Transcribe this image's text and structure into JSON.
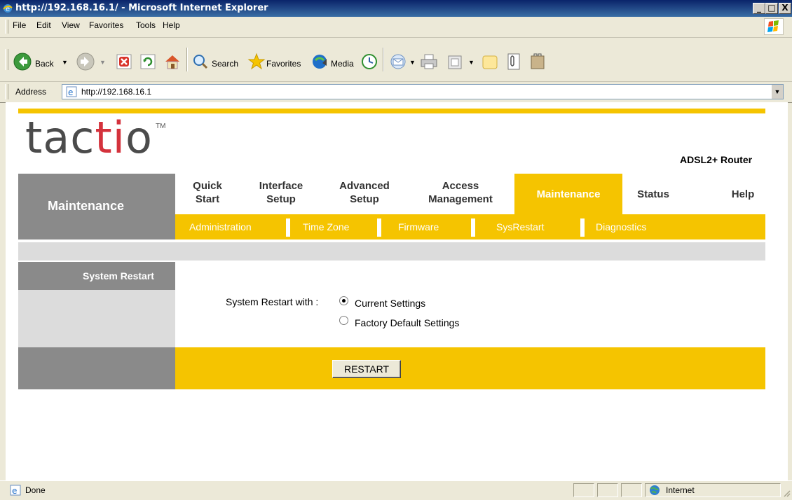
{
  "window": {
    "title": "http://192.168.16.1/ - Microsoft Internet Explorer",
    "controls": [
      "_",
      "□",
      "X"
    ]
  },
  "menu": [
    "File",
    "Edit",
    "View",
    "Favorites",
    "Tools",
    "Help"
  ],
  "toolbar": {
    "back": "Back",
    "search": "Search",
    "favorites": "Favorites",
    "media": "Media"
  },
  "address": {
    "label": "Address",
    "url": "http://192.168.16.1"
  },
  "router": {
    "logo_prefix": "tac",
    "logo_accent": "ti",
    "logo_suffix": "o",
    "trademark": "TM",
    "model": "ADSL2+ Router",
    "section": "Maintenance",
    "nav": [
      {
        "line1": "Quick",
        "line2": "Start"
      },
      {
        "line1": "Interface",
        "line2": "Setup"
      },
      {
        "line1": "Advanced",
        "line2": "Setup"
      },
      {
        "line1": "Access",
        "line2": "Management"
      },
      {
        "line1": "Maintenance",
        "line2": ""
      },
      {
        "line1": "Status",
        "line2": ""
      },
      {
        "line1": "Help",
        "line2": ""
      }
    ],
    "subnav": [
      "Administration",
      "Time Zone",
      "Firmware",
      "SysRestart",
      "Diagnostics"
    ],
    "panel_title": "System Restart",
    "restart_label": "System Restart with :",
    "options": [
      {
        "label": "Current Settings",
        "checked": true
      },
      {
        "label": "Factory Default Settings",
        "checked": false
      }
    ],
    "button": "RESTART"
  },
  "status": {
    "left": "Done",
    "zone": "Internet"
  },
  "colors": {
    "accent": "#f5c400",
    "nav_grey": "#8a8a8a",
    "light_grey": "#dcdcdc",
    "logo_red": "#d4323c",
    "logo_grey": "#4b4b4b"
  }
}
